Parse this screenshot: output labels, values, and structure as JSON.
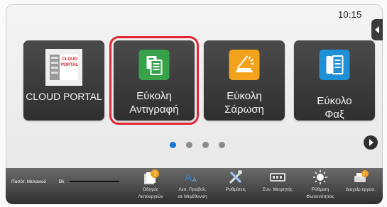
{
  "clock": "10:15",
  "tiles": [
    {
      "label": "CLOUD PORTAL",
      "logo_line1": "CLOUD",
      "logo_line2": "PORTAL"
    },
    {
      "label_line1": "Εύκολη",
      "label_line2": "Αντιγραφή"
    },
    {
      "label_line1": "Εύκολη",
      "label_line2": "Σάρωση"
    },
    {
      "label_line1": "Εύκολο",
      "label_line2": "Φαξ"
    }
  ],
  "pager": {
    "count": 4,
    "active": 1
  },
  "toolbar": {
    "ink_label": "Ποσότ. Μελανιού",
    "ink_channel": "Bk",
    "items": [
      {
        "line1": "Οδηγός",
        "line2": "Λειτουργιών"
      },
      {
        "line1": "Λειτ. Προβολ.",
        "line2": "σε Μεγέθυνση"
      },
      {
        "line1": "Ρυθμίσεις",
        "line2": ""
      },
      {
        "line1": "Συν. Μετρητής",
        "line2": ""
      },
      {
        "line1": "Ρύθμιση",
        "line2": "Φωτεινότητας"
      },
      {
        "line1": "Διαχείρ εργασ.",
        "line2": ""
      }
    ]
  },
  "colors": {
    "accent": "#1778d8",
    "highlight": "#e22434",
    "copy_green": "#37a24a",
    "scan_orange": "#f3a21c",
    "fax_blue": "#1f8fd6"
  }
}
